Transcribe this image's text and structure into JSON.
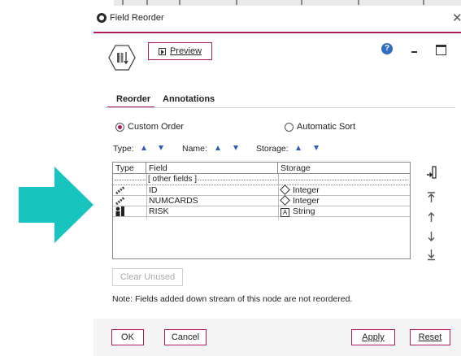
{
  "window": {
    "title": "Field Reorder"
  },
  "toolbar": {
    "preview_label": "Preview"
  },
  "tabs": [
    {
      "label": "Reorder",
      "active": true
    },
    {
      "label": "Annotations",
      "active": false
    }
  ],
  "order_mode": {
    "custom_label": "Custom Order",
    "auto_label": "Automatic Sort",
    "selected": "Custom Order"
  },
  "sort_controls": {
    "type_label": "Type:",
    "name_label": "Name:",
    "storage_label": "Storage:"
  },
  "table": {
    "headers": [
      "Type",
      "Field",
      "Storage"
    ],
    "other_fields_label": "[ other fields ]",
    "rows": [
      {
        "type_icon": "continuous-icon",
        "field": "ID",
        "storage_icon": "diamond-icon",
        "storage": "Integer"
      },
      {
        "type_icon": "continuous-icon",
        "field": "NUMCARDS",
        "storage_icon": "diamond-icon",
        "storage": "Integer"
      },
      {
        "type_icon": "target-icon",
        "field": "RISK",
        "storage_icon": "text-a-icon",
        "storage": "String",
        "storage_glyph": "A"
      }
    ]
  },
  "buttons": {
    "clear_unused": "Clear Unused",
    "ok": "OK",
    "cancel": "Cancel",
    "apply": "Apply",
    "reset": "Reset"
  },
  "note": "Note: Fields added down stream of this node are not reordered.",
  "colors": {
    "accent": "#b0185f",
    "arrow": "#17c4c0",
    "sort_arrow": "#2b5fbf",
    "help": "#2e6fc1"
  }
}
